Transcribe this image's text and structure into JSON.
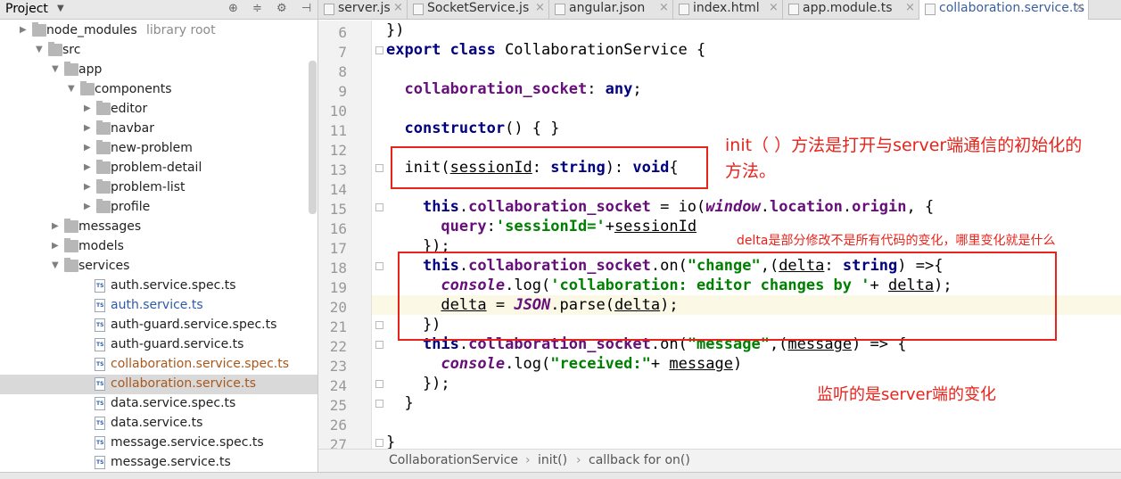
{
  "project": {
    "title": "Project"
  },
  "tree": [
    {
      "label": "node_modules",
      "sub": "library root",
      "type": "folder",
      "expanded": false
    },
    {
      "label": "src",
      "type": "folder",
      "expanded": true
    },
    {
      "label": "app",
      "type": "folder",
      "expanded": true
    },
    {
      "label": "components",
      "type": "folder",
      "expanded": true
    },
    {
      "label": "editor",
      "type": "folder",
      "expanded": false
    },
    {
      "label": "navbar",
      "type": "folder",
      "expanded": false
    },
    {
      "label": "new-problem",
      "type": "folder",
      "expanded": false
    },
    {
      "label": "problem-detail",
      "type": "folder",
      "expanded": false
    },
    {
      "label": "problem-list",
      "type": "folder",
      "expanded": false
    },
    {
      "label": "profile",
      "type": "folder",
      "expanded": false
    },
    {
      "label": "messages",
      "type": "folder",
      "expanded": false
    },
    {
      "label": "models",
      "type": "folder",
      "expanded": false
    },
    {
      "label": "services",
      "type": "folder",
      "expanded": true
    },
    {
      "label": "auth.service.spec.ts",
      "type": "file"
    },
    {
      "label": "auth.service.ts",
      "type": "file",
      "color": "#2f5aa8"
    },
    {
      "label": "auth-guard.service.spec.ts",
      "type": "file"
    },
    {
      "label": "auth-guard.service.ts",
      "type": "file"
    },
    {
      "label": "collaboration.service.spec.ts",
      "type": "file",
      "color": "#a8581c"
    },
    {
      "label": "collaboration.service.ts",
      "type": "file",
      "color": "#a8581c",
      "selected": true
    },
    {
      "label": "data.service.spec.ts",
      "type": "file"
    },
    {
      "label": "data.service.ts",
      "type": "file"
    },
    {
      "label": "message.service.spec.ts",
      "type": "file"
    },
    {
      "label": "message.service.ts",
      "type": "file"
    }
  ],
  "tabs": [
    {
      "label": "server.js",
      "active": false
    },
    {
      "label": "SocketService.js",
      "active": false
    },
    {
      "label": "angular.json",
      "active": false
    },
    {
      "label": "index.html",
      "active": false
    },
    {
      "label": "app.module.ts",
      "active": false
    },
    {
      "label": "collaboration.service.ts",
      "active": true
    }
  ],
  "line_numbers": [
    "6",
    "7",
    "8",
    "9",
    "10",
    "11",
    "12",
    "13",
    "14",
    "15",
    "16",
    "17",
    "18",
    "19",
    "20",
    "21",
    "22",
    "23",
    "24",
    "25",
    "26",
    "27"
  ],
  "code_lines": [
    [
      {
        "t": "})"
      }
    ],
    [
      {
        "t": "export class",
        "c": "k"
      },
      {
        "t": " CollaborationService {"
      }
    ],
    [
      {
        "t": ""
      }
    ],
    [
      {
        "t": "  "
      },
      {
        "t": "collaboration_socket",
        "c": "p"
      },
      {
        "t": ": "
      },
      {
        "t": "any",
        "c": "k"
      },
      {
        "t": ";"
      }
    ],
    [
      {
        "t": ""
      }
    ],
    [
      {
        "t": "  "
      },
      {
        "t": "constructor",
        "c": "k"
      },
      {
        "t": "() { }"
      }
    ],
    [
      {
        "t": ""
      }
    ],
    [
      {
        "t": "  init("
      },
      {
        "t": "sessionId",
        "c": "u"
      },
      {
        "t": ": "
      },
      {
        "t": "string",
        "c": "k"
      },
      {
        "t": "): "
      },
      {
        "t": "void",
        "c": "k"
      },
      {
        "t": "{"
      }
    ],
    [
      {
        "t": ""
      }
    ],
    [
      {
        "t": "    "
      },
      {
        "t": "this",
        "c": "k"
      },
      {
        "t": "."
      },
      {
        "t": "collaboration_socket",
        "c": "p"
      },
      {
        "t": " = io("
      },
      {
        "t": "window",
        "c": "p it"
      },
      {
        "t": "."
      },
      {
        "t": "location",
        "c": "p"
      },
      {
        "t": "."
      },
      {
        "t": "origin",
        "c": "p"
      },
      {
        "t": ", {"
      }
    ],
    [
      {
        "t": "      "
      },
      {
        "t": "query",
        "c": "p"
      },
      {
        "t": ":"
      },
      {
        "t": "'sessionId='",
        "c": "s"
      },
      {
        "t": "+"
      },
      {
        "t": "sessionId",
        "c": "u"
      }
    ],
    [
      {
        "t": "    });"
      }
    ],
    [
      {
        "t": "    "
      },
      {
        "t": "this",
        "c": "k"
      },
      {
        "t": "."
      },
      {
        "t": "collaboration_socket",
        "c": "p"
      },
      {
        "t": ".on("
      },
      {
        "t": "\"change\"",
        "c": "s"
      },
      {
        "t": ",("
      },
      {
        "t": "delta",
        "c": "u"
      },
      {
        "t": ": "
      },
      {
        "t": "string",
        "c": "k"
      },
      {
        "t": ") =>{"
      }
    ],
    [
      {
        "t": "      "
      },
      {
        "t": "console",
        "c": "p it"
      },
      {
        "t": ".log("
      },
      {
        "t": "'collaboration: editor changes by '",
        "c": "s"
      },
      {
        "t": "+ "
      },
      {
        "t": "delta",
        "c": "u"
      },
      {
        "t": ");"
      }
    ],
    [
      {
        "t": "      "
      },
      {
        "t": "delta",
        "c": "u"
      },
      {
        "t": " = "
      },
      {
        "t": "JSON",
        "c": "p it"
      },
      {
        "t": ".parse("
      },
      {
        "t": "delta",
        "c": "u"
      },
      {
        "t": ");"
      }
    ],
    [
      {
        "t": "    })"
      }
    ],
    [
      {
        "t": "    "
      },
      {
        "t": "this",
        "c": "k"
      },
      {
        "t": "."
      },
      {
        "t": "collaboration_socket",
        "c": "p"
      },
      {
        "t": ".on("
      },
      {
        "t": "\"message\"",
        "c": "s"
      },
      {
        "t": ",("
      },
      {
        "t": "message",
        "c": "u"
      },
      {
        "t": ") => {"
      }
    ],
    [
      {
        "t": "      "
      },
      {
        "t": "console",
        "c": "p it"
      },
      {
        "t": ".log("
      },
      {
        "t": "\"received:\"",
        "c": "s"
      },
      {
        "t": "+ "
      },
      {
        "t": "message",
        "c": "u"
      },
      {
        "t": ")"
      }
    ],
    [
      {
        "t": "    });"
      }
    ],
    [
      {
        "t": "  }"
      }
    ],
    [
      {
        "t": ""
      }
    ],
    [
      {
        "t": "}"
      }
    ]
  ],
  "annotations": {
    "init_note_line1": "init（ ）方法是打开与server端通信的初始化的",
    "init_note_line2": "方法。",
    "delta_note": "delta是部分修改不是所有代码的变化，哪里变化就是什么",
    "listen_note": "监听的是server端的变化"
  },
  "breadcrumb": [
    "CollaborationService",
    "init()",
    "callback for on()"
  ],
  "colors": {
    "accent_red": "#e8231b",
    "keyword": "#000080",
    "property": "#660e7a",
    "string": "#008000"
  }
}
